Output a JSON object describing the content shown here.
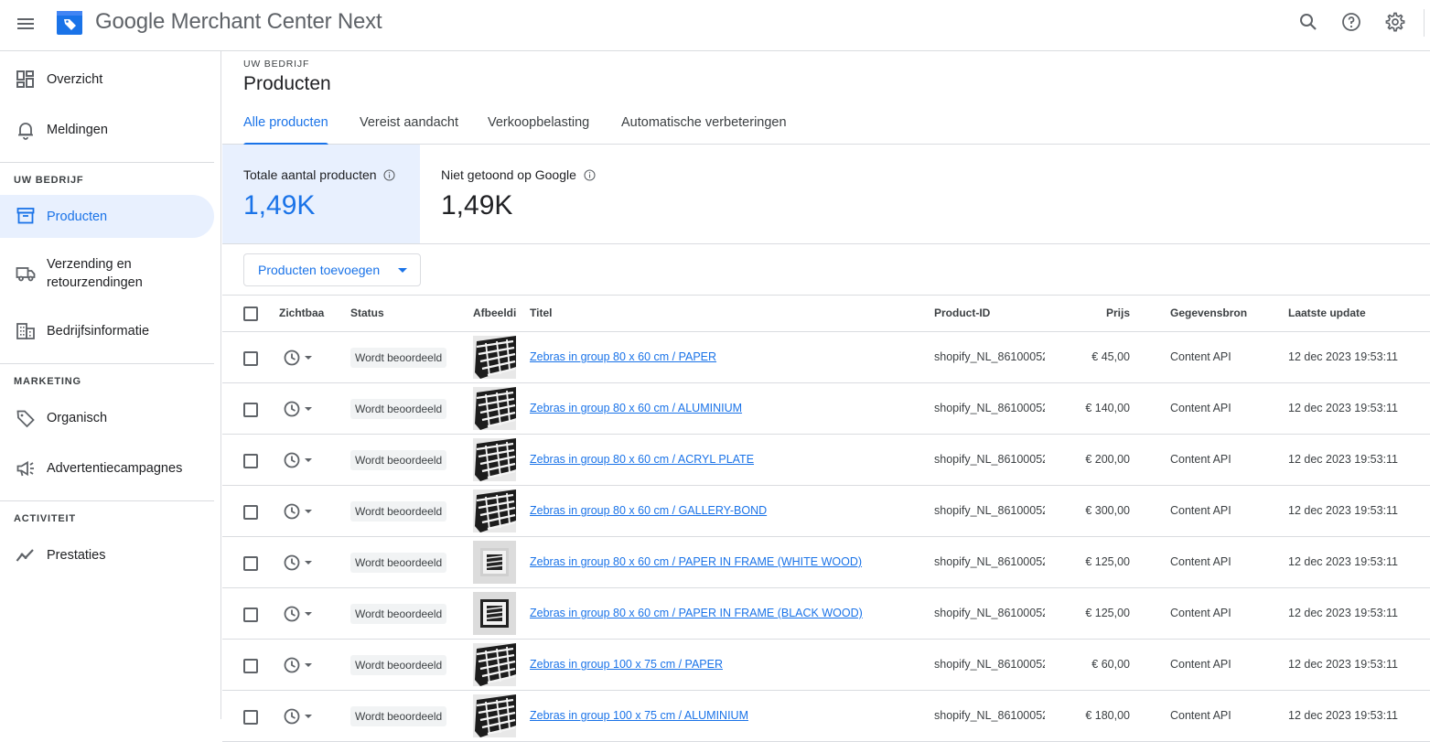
{
  "app": {
    "title_brand": "Google",
    "title_rest": "Merchant Center Next"
  },
  "colors": {
    "accent": "#1a73e8",
    "active_bg": "#e8f0fe",
    "divider": "#dadce0"
  },
  "topbar": {
    "icons": [
      "search-icon",
      "help-icon",
      "settings-icon"
    ]
  },
  "sidebar": {
    "items": [
      {
        "label": "Overzicht",
        "icon": "dashboard-icon"
      },
      {
        "label": "Meldingen",
        "icon": "bell-icon"
      },
      {
        "label": "Producten",
        "icon": "archive-box-icon",
        "active": true
      },
      {
        "label": "Verzending en",
        "label2": "retourzendingen",
        "icon": "truck-icon"
      },
      {
        "label": "Bedrijfsinformatie",
        "icon": "building-icon"
      },
      {
        "label": "Organisch",
        "icon": "tag-icon"
      },
      {
        "label": "Advertentiecampagnes",
        "icon": "megaphone-icon"
      },
      {
        "label": "Prestaties",
        "icon": "trend-icon"
      }
    ],
    "sections": [
      "UW BEDRIJF",
      "MARKETING",
      "ACTIVITEIT"
    ]
  },
  "main": {
    "eyebrow": "UW BEDRIJF",
    "title": "Producten",
    "tabs": [
      {
        "label": "Alle producten",
        "active": true
      },
      {
        "label": "Vereist aandacht"
      },
      {
        "label": "Verkoopbelasting"
      },
      {
        "label": "Automatische verbeteringen"
      }
    ],
    "stats": [
      {
        "label": "Totale aantal producten",
        "value": "1,49K",
        "selected": true
      },
      {
        "label": "Niet getoond op Google",
        "value": "1,49K"
      }
    ],
    "add_button": "Producten toevoegen"
  },
  "table": {
    "headers": [
      "Zichtbaa",
      "Status",
      "Afbeeldi",
      "Titel",
      "Product-ID",
      "Prijs",
      "Gegevensbron",
      "Laatste update"
    ],
    "rows": [
      {
        "status": "Wordt beoordeeld",
        "title": "Zebras in group 80 x 60 cm / PAPER",
        "product_id": "shopify_NL_86100052",
        "price": "€ 45,00",
        "source": "Content API",
        "updated": "12 dec 2023 19:53:11",
        "thumb": "photo"
      },
      {
        "status": "Wordt beoordeeld",
        "title": "Zebras in group 80 x 60 cm / ALUMINIUM",
        "product_id": "shopify_NL_86100052",
        "price": "€ 140,00",
        "source": "Content API",
        "updated": "12 dec 2023 19:53:11",
        "thumb": "photo"
      },
      {
        "status": "Wordt beoordeeld",
        "title": "Zebras in group 80 x 60 cm / ACRYL PLATE",
        "product_id": "shopify_NL_86100052",
        "price": "€ 200,00",
        "source": "Content API",
        "updated": "12 dec 2023 19:53:11",
        "thumb": "photo"
      },
      {
        "status": "Wordt beoordeeld",
        "title": "Zebras in group 80 x 60 cm / GALLERY-BOND",
        "product_id": "shopify_NL_86100052",
        "price": "€ 300,00",
        "source": "Content API",
        "updated": "12 dec 2023 19:53:11",
        "thumb": "photo"
      },
      {
        "status": "Wordt beoordeeld",
        "title": "Zebras in group 80 x 60 cm / PAPER IN FRAME (WHITE WOOD)",
        "product_id": "shopify_NL_86100052",
        "price": "€ 125,00",
        "source": "Content API",
        "updated": "12 dec 2023 19:53:11",
        "thumb": "frame-white"
      },
      {
        "status": "Wordt beoordeeld",
        "title": "Zebras in group 80 x 60 cm / PAPER IN FRAME (BLACK WOOD)",
        "product_id": "shopify_NL_86100052",
        "price": "€ 125,00",
        "source": "Content API",
        "updated": "12 dec 2023 19:53:11",
        "thumb": "frame-black"
      },
      {
        "status": "Wordt beoordeeld",
        "title": "Zebras in group 100 x 75 cm / PAPER",
        "product_id": "shopify_NL_86100052",
        "price": "€ 60,00",
        "source": "Content API",
        "updated": "12 dec 2023 19:53:11",
        "thumb": "photo"
      },
      {
        "status": "Wordt beoordeeld",
        "title": "Zebras in group 100 x 75 cm / ALUMINIUM",
        "product_id": "shopify_NL_86100052",
        "price": "€ 180,00",
        "source": "Content API",
        "updated": "12 dec 2023 19:53:11",
        "thumb": "photo"
      }
    ]
  }
}
